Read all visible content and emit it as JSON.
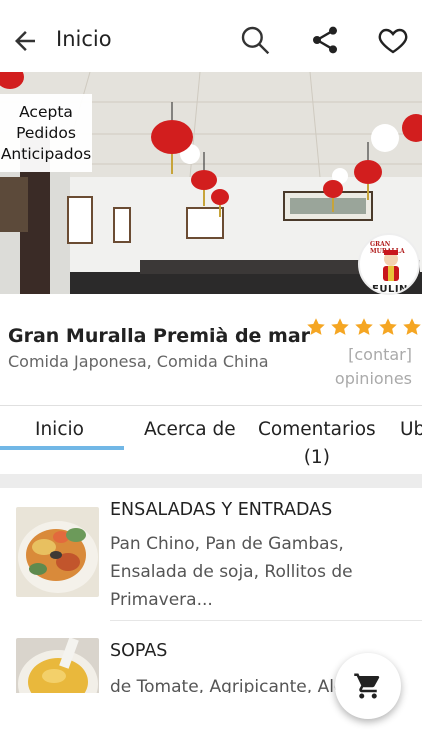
{
  "appbar": {
    "title": "Inicio",
    "back_icon": "arrow-back-icon",
    "search_icon": "search-icon",
    "share_icon": "share-icon",
    "favorite_icon": "heart-outline-icon"
  },
  "hero": {
    "badge_lines": [
      "Acepta",
      "Pedidos",
      "Anticipados"
    ],
    "logo_text": "GRAN MURALLA",
    "logo_bottom_text": "FULIN"
  },
  "restaurant": {
    "name": "Gran Muralla Premià de mar",
    "cuisine": "Comida Japonesa, Comida China",
    "stars": 5,
    "star_color": "#f5a623",
    "rating_link": "[contar]",
    "rating_opinions": "opiniones"
  },
  "tabs": [
    {
      "label": "Inicio"
    },
    {
      "label": "Acerca de"
    },
    {
      "label": "Comentarios",
      "count": "(1)"
    },
    {
      "label": "Ub"
    }
  ],
  "accent_color": "#71b7e6",
  "menu": [
    {
      "title": "ENSALADAS Y ENTRADAS",
      "desc_lines": [
        "Pan Chino, Pan de Gambas,",
        "Ensalada de soja, Rollitos de",
        "Primavera..."
      ]
    },
    {
      "title": "SOPAS",
      "desc_lines": [
        "de Tomate, Agripicante, Ale"
      ]
    }
  ],
  "fab": {
    "icon": "shopping-cart-icon"
  }
}
